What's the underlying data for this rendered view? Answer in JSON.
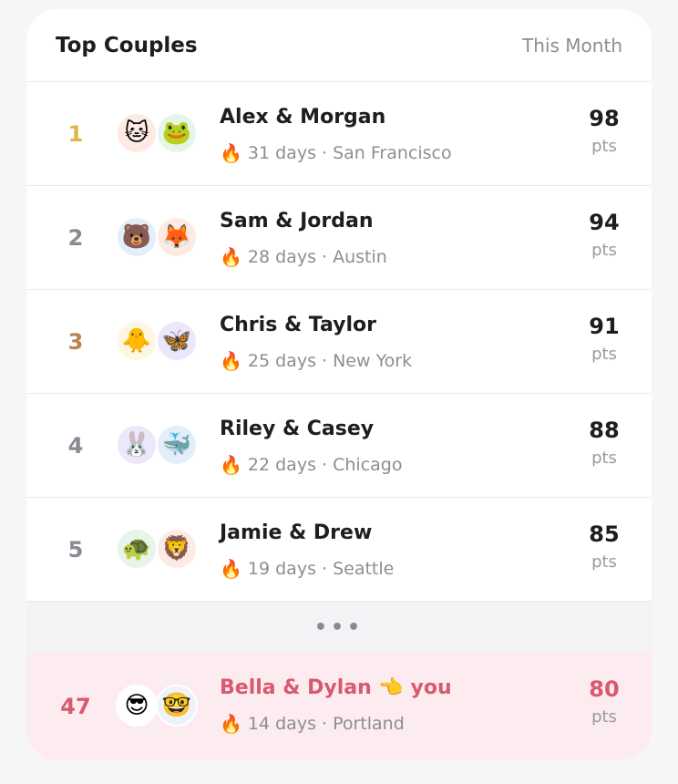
{
  "header": {
    "title": "Top Couples",
    "filter": "This Month"
  },
  "colors": {
    "gold": "#e3b341",
    "silver": "#8a8a92",
    "bronze": "#b9834a",
    "me": "#d9596f"
  },
  "rows": [
    {
      "rank": "1",
      "rank_color": "#e3b341",
      "name": "Alex & Morgan",
      "avatars": [
        {
          "emoji": "🐱",
          "bg": "#fdeae3"
        },
        {
          "emoji": "🐸",
          "bg": "#e6f5ea"
        }
      ],
      "fire": "🔥",
      "meta": "31 days · San Francisco",
      "points": "98",
      "pts_label": "pts"
    },
    {
      "rank": "2",
      "rank_color": "#8a8a92",
      "name": "Sam & Jordan",
      "avatars": [
        {
          "emoji": "🐻",
          "bg": "#e3eefb"
        },
        {
          "emoji": "🦊",
          "bg": "#fdeae3"
        }
      ],
      "fire": "🔥",
      "meta": "28 days · Austin",
      "points": "94",
      "pts_label": "pts"
    },
    {
      "rank": "3",
      "rank_color": "#b9834a",
      "name": "Chris & Taylor",
      "avatars": [
        {
          "emoji": "🐥",
          "bg": "#fdf6e0"
        },
        {
          "emoji": "🦋",
          "bg": "#ece7fb"
        }
      ],
      "fire": "🔥",
      "meta": "25 days · New York",
      "points": "91",
      "pts_label": "pts"
    },
    {
      "rank": "4",
      "rank_color": "#8a8a92",
      "name": "Riley & Casey",
      "avatars": [
        {
          "emoji": "🐰",
          "bg": "#ece7fb"
        },
        {
          "emoji": "🐳",
          "bg": "#e3eefb"
        }
      ],
      "fire": "🔥",
      "meta": "22 days · Chicago",
      "points": "88",
      "pts_label": "pts"
    },
    {
      "rank": "5",
      "rank_color": "#8a8a92",
      "name": "Jamie & Drew",
      "avatars": [
        {
          "emoji": "🐢",
          "bg": "#e6f5ea"
        },
        {
          "emoji": "🦁",
          "bg": "#fdeae3"
        }
      ],
      "fire": "🔥",
      "meta": "19 days · Seattle",
      "points": "85",
      "pts_label": "pts"
    }
  ],
  "gap": "•••",
  "me": {
    "rank": "47",
    "name": "Bella & Dylan 👈 you",
    "avatars": [
      {
        "emoji": "😎",
        "bg": "#ffffff"
      },
      {
        "emoji": "🤓",
        "bg": "#eef3fb"
      }
    ],
    "fire": "🔥",
    "meta": "14 days · Portland",
    "points": "80",
    "pts_label": "pts"
  }
}
